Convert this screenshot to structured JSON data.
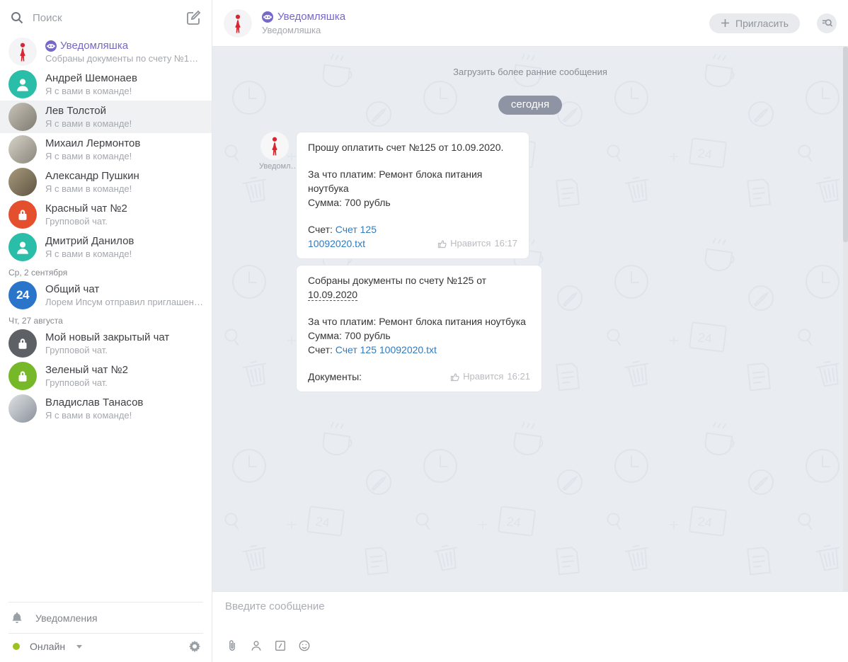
{
  "colors": {
    "accent_purple": "#7668c9",
    "link_blue": "#2f7bc0",
    "online_green": "#9dc21f",
    "chat_background": "#e9edf2",
    "day_pill": "#8e94a3",
    "avatar_teal": "#2abda8",
    "avatar_red": "#e4502e",
    "avatar_blue": "#2a74c9",
    "avatar_dark": "#5d6064",
    "avatar_green": "#76b827",
    "bot_silhouette_red": "#d8252f"
  },
  "sidebar": {
    "search_placeholder": "Поиск",
    "chats": [
      {
        "name": "Уведомляшка",
        "preview": "Собраны документы по счету №12…"
      },
      {
        "name": "Андрей Шемонаев",
        "preview": "Я с вами в команде!"
      },
      {
        "name": "Лев Толстой",
        "preview": "Я с вами в команде!"
      },
      {
        "name": "Михаил Лермонтов",
        "preview": "Я с вами в команде!"
      },
      {
        "name": "Александр Пушкин",
        "preview": "Я с вами в команде!"
      },
      {
        "name": "Красный чат №2",
        "preview": "Групповой чат."
      },
      {
        "name": "Дмитрий Данилов",
        "preview": "Я с вами в команде!"
      },
      {
        "name": "Общий чат",
        "preview": "Лорем Ипсум отправил приглашен…",
        "badge": "24"
      },
      {
        "name": "Мой новый закрытый чат",
        "preview": "Групповой чат."
      },
      {
        "name": "Зеленый чат №2",
        "preview": "Групповой чат."
      },
      {
        "name": "Владислав Танасов",
        "preview": "Я с вами в команде!"
      }
    ],
    "divider_sep2": "Ср, 2 сентября",
    "divider_aug27": "Чт, 27 августа",
    "footer": {
      "notifications_label": "Уведомления",
      "status_label": "Онлайн"
    }
  },
  "header": {
    "title": "Уведомляшка",
    "subtitle": "Уведомляшка",
    "invite_label": "Пригласить"
  },
  "thread": {
    "load_earlier": "Загрузить более ранние сообщения",
    "day_badge": "сегодня",
    "sender_caption": "Уведомл…",
    "messages": [
      {
        "line1": "Прошу оплатить счет №125 от 10.09.2020.",
        "line2": "За что платим: Ремонт блока питания ноутбука",
        "line3": "Сумма: 700 рубль",
        "line4_label": "Счет: ",
        "line4_link": "Счет 125 10092020.txt",
        "like_label": "Нравится",
        "time": "16:17"
      },
      {
        "line1_prefix": "Собраны документы по счету №125 от ",
        "line1_date": "10.09.2020",
        "line2": "За что платим: Ремонт блока питания ноутбука",
        "line3": "Сумма: 700 рубль",
        "line4_label": "Счет: ",
        "line4_link": "Счет 125 10092020.txt",
        "line5": "Документы:",
        "like_label": "Нравится",
        "time": "16:21"
      }
    ]
  },
  "composer": {
    "placeholder": "Введите сообщение"
  }
}
